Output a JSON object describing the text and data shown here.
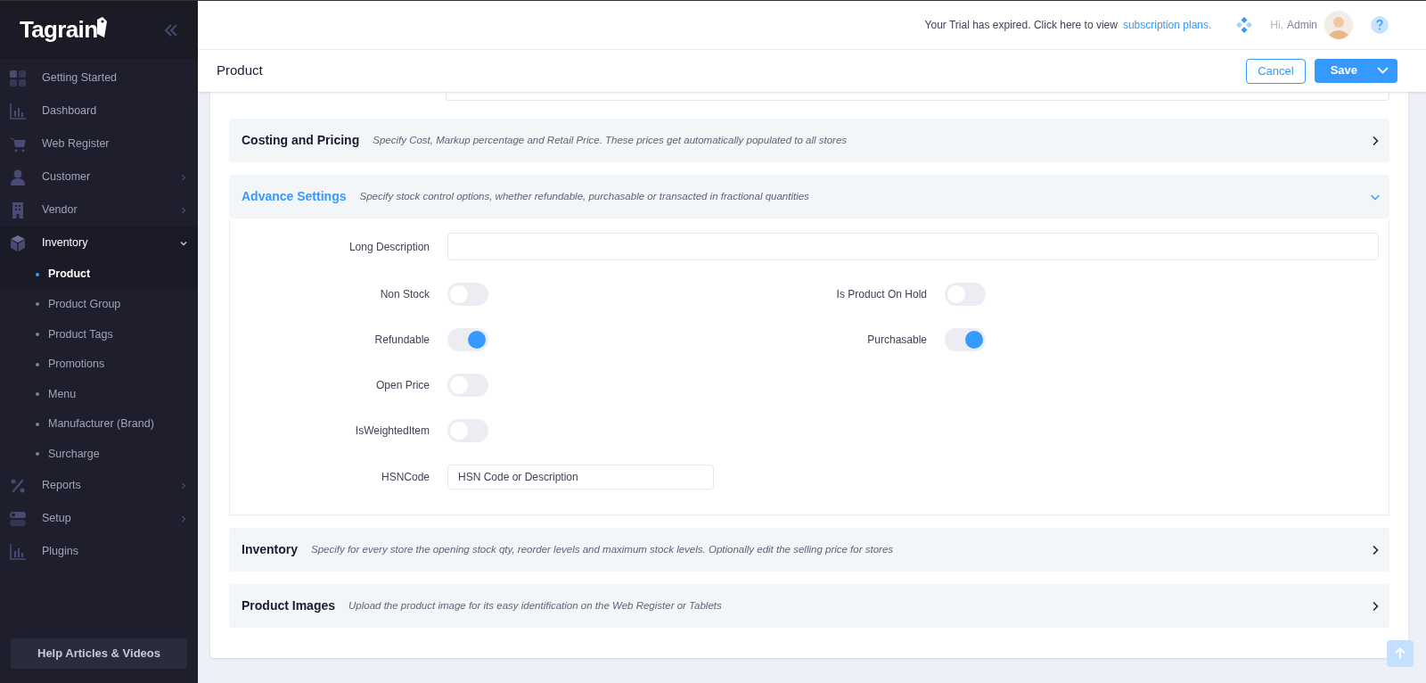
{
  "sidebar": {
    "logo": "Tagrain",
    "items": [
      {
        "label": "Getting Started",
        "selected": false
      },
      {
        "label": "Dashboard",
        "selected": false
      },
      {
        "label": "Web Register",
        "selected": false
      },
      {
        "label": "Customer",
        "selected": false,
        "expanded": false
      },
      {
        "label": "Vendor",
        "selected": false,
        "expanded": false
      },
      {
        "label": "Inventory",
        "selected": true,
        "expanded": true,
        "children": [
          {
            "label": "Product",
            "selected": true
          },
          {
            "label": "Product Group",
            "selected": false
          },
          {
            "label": "Product Tags",
            "selected": false
          },
          {
            "label": "Promotions",
            "selected": false
          },
          {
            "label": "Menu",
            "selected": false
          },
          {
            "label": "Manufacturer (Brand)",
            "selected": false
          },
          {
            "label": "Surcharge",
            "selected": false
          }
        ]
      },
      {
        "label": "Reports",
        "selected": false,
        "expanded": false
      },
      {
        "label": "Setup",
        "selected": false,
        "expanded": false
      },
      {
        "label": "Plugins",
        "selected": false
      }
    ],
    "help_button": "Help Articles & Videos"
  },
  "topbar": {
    "notice": "Your Trial has expired. Click here to view",
    "notice_link": "subscription plans.",
    "greeting": "Hi,",
    "user": "Admin"
  },
  "page": {
    "title": "Product",
    "buttons": [
      "Cancel",
      "Save"
    ]
  },
  "sections": [
    {
      "title": "Costing and Pricing",
      "description": "Specify Cost, Markup percentage and Retail Price. These prices get automatically populated to all stores",
      "expanded": false
    },
    {
      "title": "Advance Settings",
      "description": "Specify stock control options, whether refundable, purchasable or transacted in fractional quantities",
      "expanded": true,
      "long_description": {
        "label": "Long Description"
      },
      "toggle_rows": [
        [
          {
            "label": "Non Stock",
            "on": false
          },
          {
            "label": "Is Product On Hold",
            "on": false
          }
        ],
        [
          {
            "label": "Refundable",
            "on": true
          },
          {
            "label": "Purchasable",
            "on": true
          }
        ],
        [
          {
            "label": "Open Price",
            "on": false
          }
        ],
        [
          {
            "label": "IsWeightedItem",
            "on": false
          }
        ]
      ],
      "hsn": {
        "label": "HSNCode",
        "placeholder": "HSN Code or Description"
      }
    },
    {
      "title": "Inventory",
      "description": "Specify for every store the opening stock qty, reorder levels and maximum stock levels. Optionally edit the selling price for stores",
      "expanded": false
    },
    {
      "title": "Product Images",
      "description": "Upload the product image for its easy identification on the Web Register or Tablets",
      "expanded": false
    }
  ]
}
